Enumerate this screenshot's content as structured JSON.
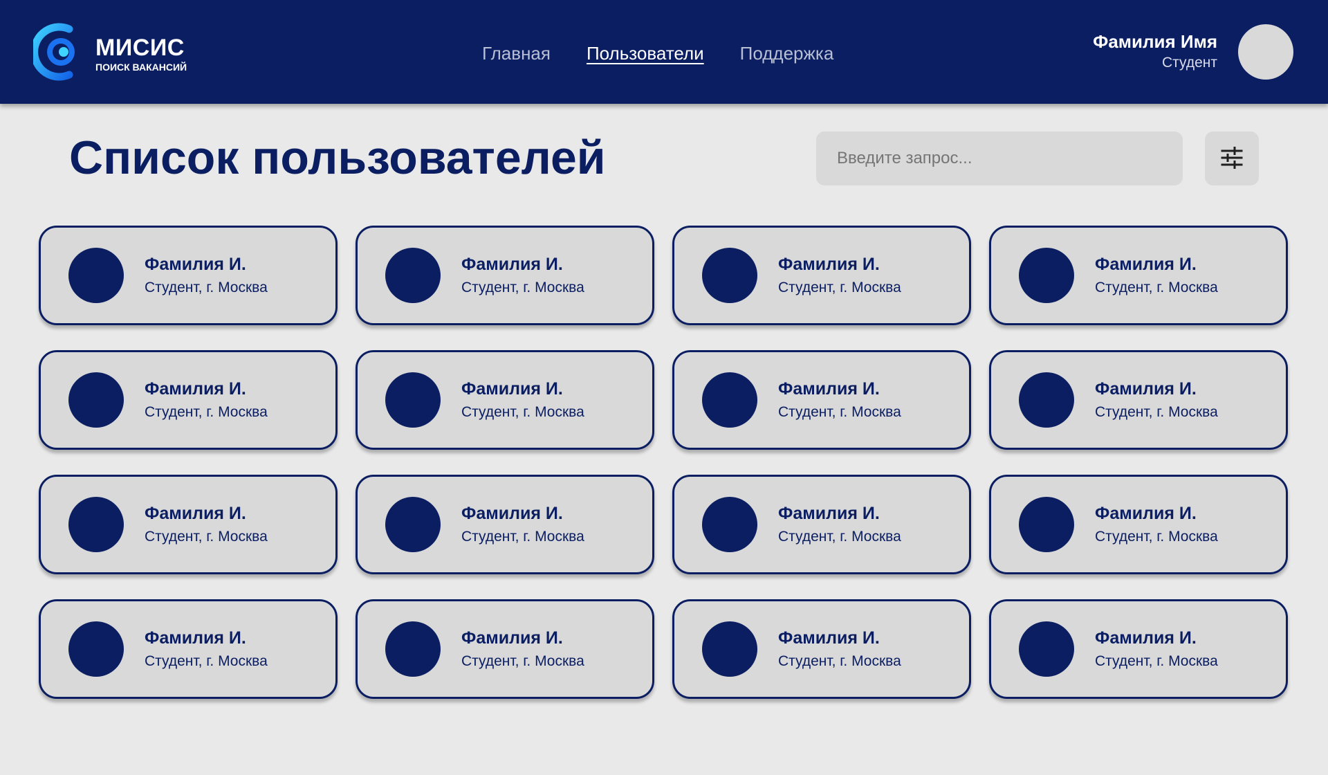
{
  "colors": {
    "brand": "#0b1e62",
    "background": "#e9e9e9",
    "card": "#d9d9d9",
    "logo_accent": "#23b6f5"
  },
  "header": {
    "logo": {
      "name": "МИСИС",
      "subtitle": "ПОИСК ВАКАНСИЙ",
      "icon": "misis-logo-icon"
    },
    "nav": [
      {
        "label": "Главная",
        "active": false
      },
      {
        "label": "Пользователи",
        "active": true
      },
      {
        "label": "Поддержка",
        "active": false
      }
    ],
    "user": {
      "name": "Фамилия Имя",
      "role": "Студент",
      "avatar_icon": "avatar"
    }
  },
  "main": {
    "title": "Список пользователей",
    "search": {
      "placeholder": "Введите запрос...",
      "value": ""
    },
    "filter_icon": "filter-sliders-icon",
    "users": [
      {
        "name": "Фамилия И.",
        "desc": "Студент, г. Москва"
      },
      {
        "name": "Фамилия И.",
        "desc": "Студент, г. Москва"
      },
      {
        "name": "Фамилия И.",
        "desc": "Студент, г. Москва"
      },
      {
        "name": "Фамилия И.",
        "desc": "Студент, г. Москва"
      },
      {
        "name": "Фамилия И.",
        "desc": "Студент, г. Москва"
      },
      {
        "name": "Фамилия И.",
        "desc": "Студент, г. Москва"
      },
      {
        "name": "Фамилия И.",
        "desc": "Студент, г. Москва"
      },
      {
        "name": "Фамилия И.",
        "desc": "Студент, г. Москва"
      },
      {
        "name": "Фамилия И.",
        "desc": "Студент, г. Москва"
      },
      {
        "name": "Фамилия И.",
        "desc": "Студент, г. Москва"
      },
      {
        "name": "Фамилия И.",
        "desc": "Студент, г. Москва"
      },
      {
        "name": "Фамилия И.",
        "desc": "Студент, г. Москва"
      },
      {
        "name": "Фамилия И.",
        "desc": "Студент, г. Москва"
      },
      {
        "name": "Фамилия И.",
        "desc": "Студент, г. Москва"
      },
      {
        "name": "Фамилия И.",
        "desc": "Студент, г. Москва"
      },
      {
        "name": "Фамилия И.",
        "desc": "Студент, г. Москва"
      }
    ]
  }
}
